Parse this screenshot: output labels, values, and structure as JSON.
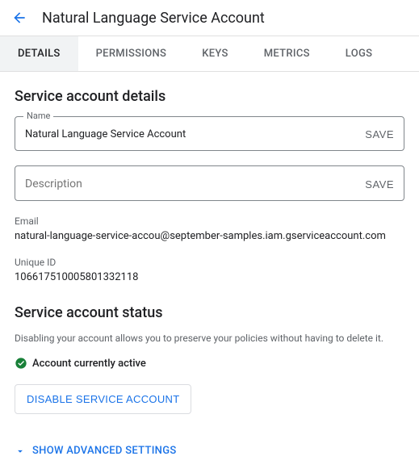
{
  "header": {
    "title": "Natural Language Service Account"
  },
  "tabs": {
    "details": "DETAILS",
    "permissions": "PERMISSIONS",
    "keys": "KEYS",
    "metrics": "METRICS",
    "logs": "LOGS"
  },
  "details": {
    "section_title": "Service account details",
    "name_label": "Name",
    "name_value": "Natural Language Service Account",
    "name_save": "SAVE",
    "description_placeholder": "Description",
    "description_save": "SAVE",
    "email_label": "Email",
    "email_value": "natural-language-service-accou@september-samples.iam.gserviceaccount.com",
    "uniqueid_label": "Unique ID",
    "uniqueid_value": "106617510005801332118"
  },
  "status": {
    "section_title": "Service account status",
    "description": "Disabling your account allows you to preserve your policies without having to delete it.",
    "active_text": "Account currently active",
    "disable_button": "DISABLE SERVICE ACCOUNT"
  },
  "advanced": {
    "label": "SHOW ADVANCED SETTINGS"
  }
}
